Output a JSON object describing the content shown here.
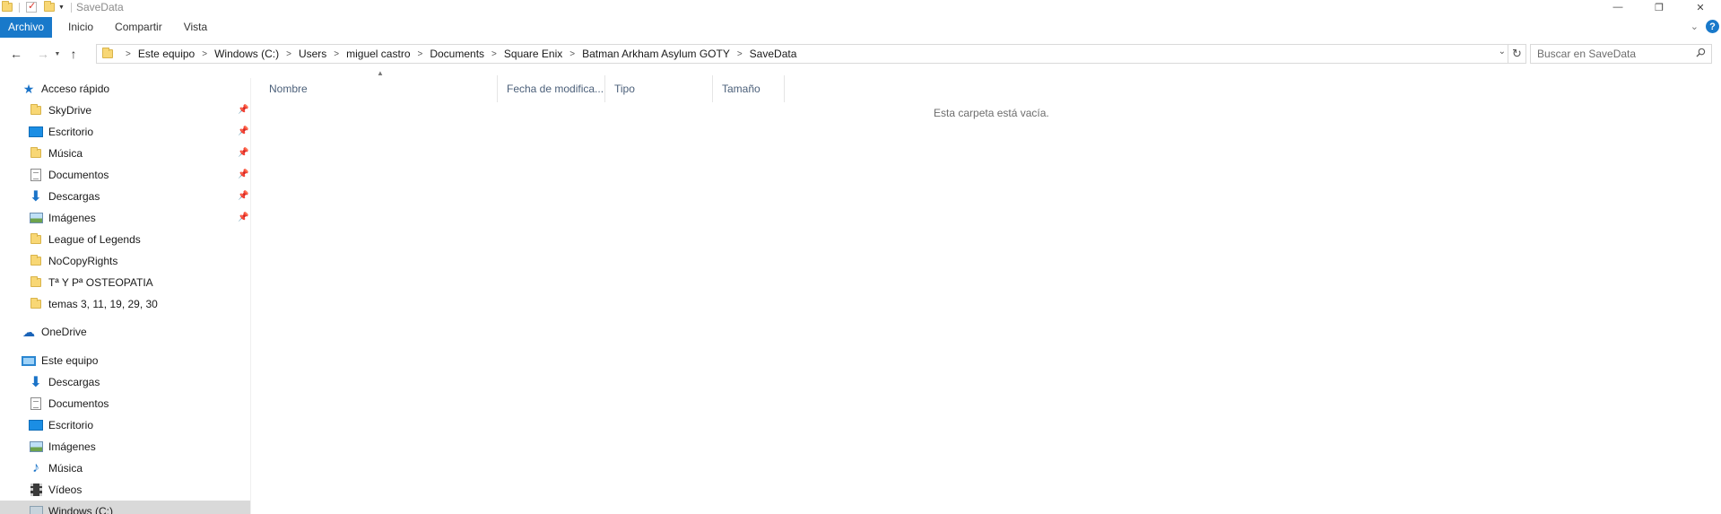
{
  "window": {
    "title": "SaveData"
  },
  "ribbon": {
    "tabs": [
      "Archivo",
      "Inicio",
      "Compartir",
      "Vista"
    ],
    "help_label": "?"
  },
  "navigation": {
    "breadcrumbs": [
      "Este equipo",
      "Windows (C:)",
      "Users",
      "miguel castro",
      "Documents",
      "Square Enix",
      "Batman Arkham Asylum GOTY",
      "SaveData"
    ],
    "search_placeholder": "Buscar en SaveData"
  },
  "sidebar": {
    "quick_access": {
      "label": "Acceso rápido",
      "items": [
        {
          "label": "SkyDrive",
          "icon": "folder-icon",
          "pinned": true
        },
        {
          "label": "Escritorio",
          "icon": "desktop-icon",
          "pinned": true
        },
        {
          "label": "Música",
          "icon": "folder-icon",
          "pinned": true
        },
        {
          "label": "Documentos",
          "icon": "documents-icon",
          "pinned": true
        },
        {
          "label": "Descargas",
          "icon": "downloads-icon",
          "pinned": true
        },
        {
          "label": "Imágenes",
          "icon": "pictures-icon",
          "pinned": true
        },
        {
          "label": "League of Legends",
          "icon": "folder-icon",
          "pinned": false
        },
        {
          "label": "NoCopyRights",
          "icon": "folder-icon",
          "pinned": false
        },
        {
          "label": "Tª Y Pª OSTEOPATIA",
          "icon": "folder-icon",
          "pinned": false
        },
        {
          "label": "temas 3, 11, 19, 29, 30",
          "icon": "folder-icon",
          "pinned": false
        }
      ]
    },
    "onedrive": {
      "label": "OneDrive"
    },
    "this_pc": {
      "label": "Este equipo",
      "items": [
        {
          "label": "Descargas",
          "icon": "downloads-icon"
        },
        {
          "label": "Documentos",
          "icon": "documents-icon"
        },
        {
          "label": "Escritorio",
          "icon": "desktop-icon"
        },
        {
          "label": "Imágenes",
          "icon": "pictures-icon"
        },
        {
          "label": "Música",
          "icon": "music-icon"
        },
        {
          "label": "Vídeos",
          "icon": "videos-icon"
        },
        {
          "label": "Windows (C:)",
          "icon": "drive-icon",
          "selected": true
        }
      ]
    }
  },
  "content": {
    "columns": [
      "Nombre",
      "Fecha de modifica...",
      "Tipo",
      "Tamaño"
    ],
    "empty_message": "Esta carpeta está vacía."
  },
  "colors": {
    "accent": "#1979ca",
    "folder": "#f8d775",
    "selected_bg": "#d9d9d9"
  }
}
